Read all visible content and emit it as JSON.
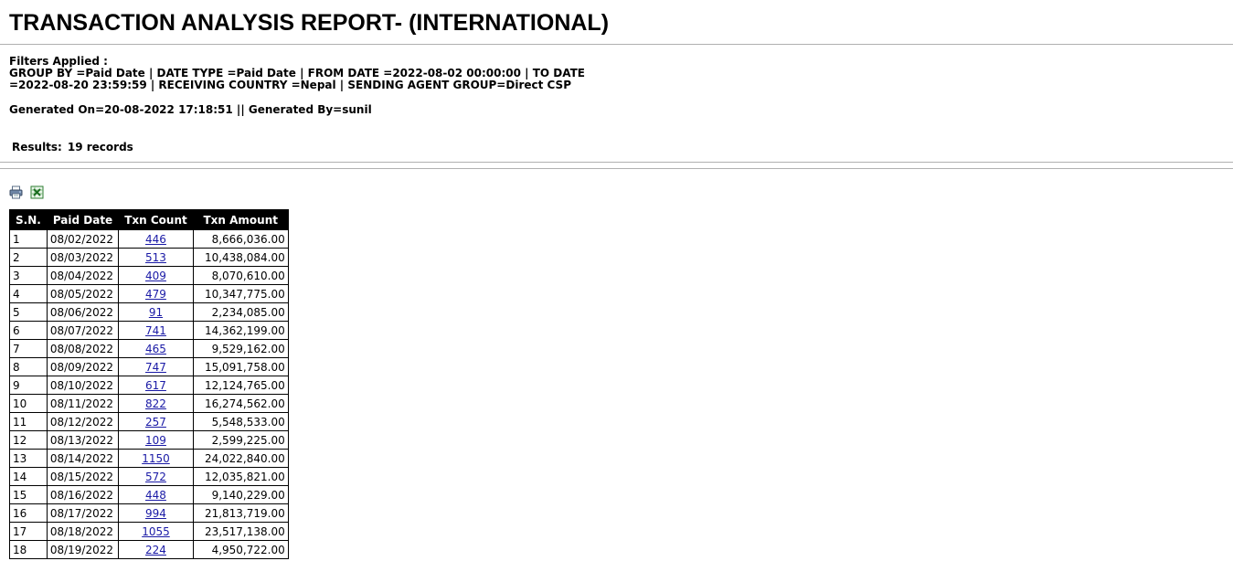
{
  "title": "TRANSACTION ANALYSIS REPORT- (INTERNATIONAL)",
  "filters": {
    "label": "Filters Applied :",
    "line1": "GROUP BY =Paid Date | DATE TYPE =Paid Date | FROM DATE =2022-08-02 00:00:00 | TO DATE",
    "line2": "=2022-08-20 23:59:59 | RECEIVING COUNTRY =Nepal | SENDING AGENT GROUP=Direct CSP"
  },
  "generated": "Generated On=20-08-2022 17:18:51 || Generated By=sunil",
  "results": {
    "label": "Results:",
    "value": "19 records"
  },
  "icons": {
    "print": "print-icon",
    "excel": "excel-icon"
  },
  "colors": {
    "header_bg": "#000000",
    "link": "#1a1aa6",
    "rule": "#b0b0b0"
  },
  "table": {
    "headers": [
      "S.N.",
      "Paid Date",
      "Txn Count",
      "Txn Amount"
    ],
    "rows": [
      [
        "1",
        "08/02/2022",
        "446",
        "8,666,036.00"
      ],
      [
        "2",
        "08/03/2022",
        "513",
        "10,438,084.00"
      ],
      [
        "3",
        "08/04/2022",
        "409",
        "8,070,610.00"
      ],
      [
        "4",
        "08/05/2022",
        "479",
        "10,347,775.00"
      ],
      [
        "5",
        "08/06/2022",
        "91",
        "2,234,085.00"
      ],
      [
        "6",
        "08/07/2022",
        "741",
        "14,362,199.00"
      ],
      [
        "7",
        "08/08/2022",
        "465",
        "9,529,162.00"
      ],
      [
        "8",
        "08/09/2022",
        "747",
        "15,091,758.00"
      ],
      [
        "9",
        "08/10/2022",
        "617",
        "12,124,765.00"
      ],
      [
        "10",
        "08/11/2022",
        "822",
        "16,274,562.00"
      ],
      [
        "11",
        "08/12/2022",
        "257",
        "5,548,533.00"
      ],
      [
        "12",
        "08/13/2022",
        "109",
        "2,599,225.00"
      ],
      [
        "13",
        "08/14/2022",
        "1150",
        "24,022,840.00"
      ],
      [
        "14",
        "08/15/2022",
        "572",
        "12,035,821.00"
      ],
      [
        "15",
        "08/16/2022",
        "448",
        "9,140,229.00"
      ],
      [
        "16",
        "08/17/2022",
        "994",
        "21,813,719.00"
      ],
      [
        "17",
        "08/18/2022",
        "1055",
        "23,517,138.00"
      ],
      [
        "18",
        "08/19/2022",
        "224",
        "4,950,722.00"
      ]
    ]
  }
}
